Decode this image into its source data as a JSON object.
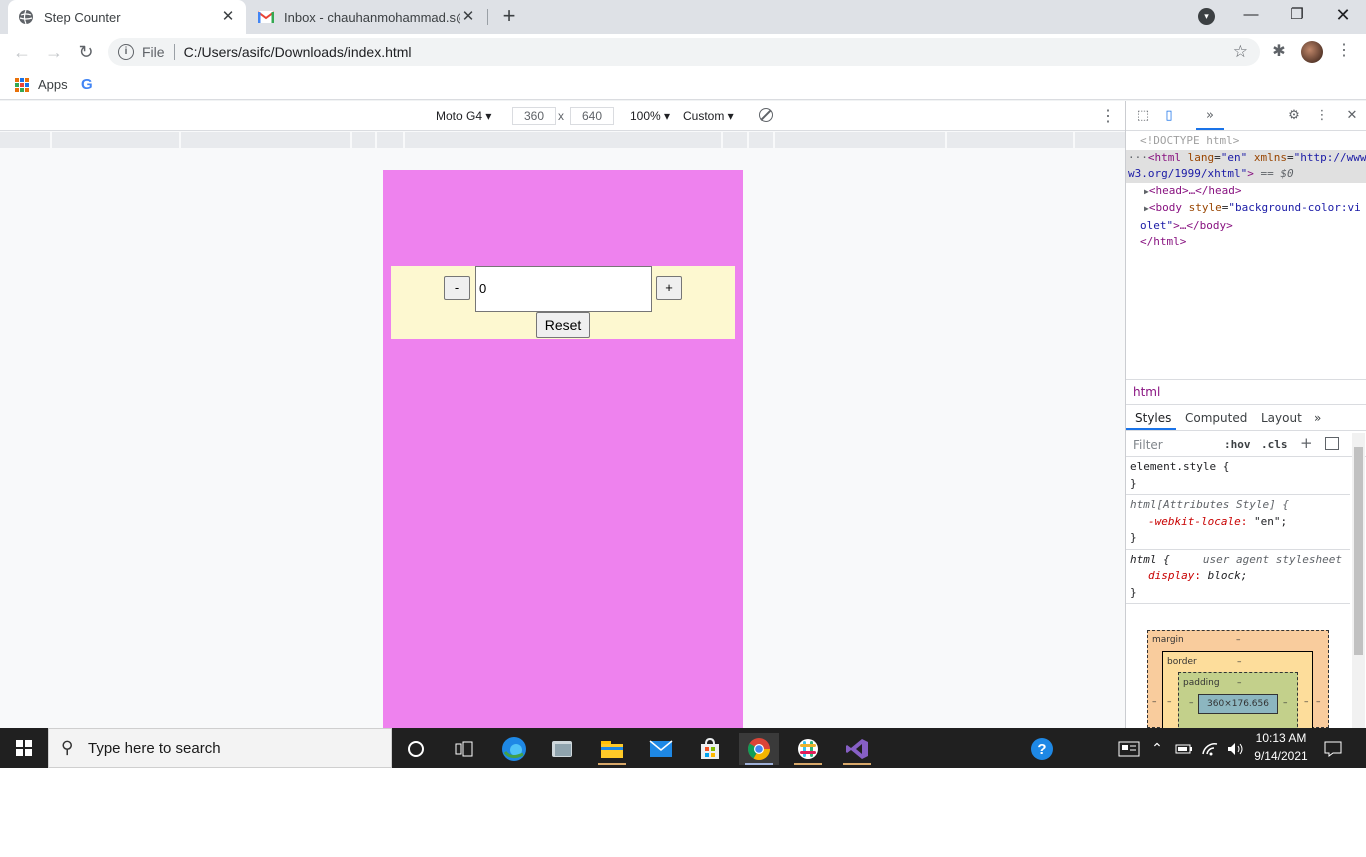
{
  "browser": {
    "tabs": [
      {
        "title": "Step Counter",
        "active": true,
        "favicon": "globe-icon"
      },
      {
        "title": "Inbox - chauhanmohammad.s@",
        "active": false,
        "favicon": "gmail-icon"
      }
    ],
    "address": {
      "scheme": "File",
      "url": "C:/Users/asifc/Downloads/index.html"
    },
    "bookmarks": {
      "apps_label": "Apps",
      "google_icon": "G"
    }
  },
  "device_toolbar": {
    "device": "Moto G4",
    "width": "360",
    "times": "x",
    "height": "640",
    "zoom": "100%",
    "throttle": "Custom"
  },
  "page": {
    "background": "#ee82ee",
    "minus_label": "-",
    "counter_value": "0",
    "plus_label": "+",
    "reset_label": "Reset"
  },
  "devtools": {
    "dom": {
      "doctype": "<!DOCTYPE html>",
      "html_open_prefix": "<html",
      "html_lang_attr": "lang",
      "html_lang_val": "\"en\"",
      "html_xmlns_attr": "xmlns",
      "html_xmlns_val": "\"http://www.",
      "html_xmlns_cont": "w3.org/1999/xhtml\"",
      "html_open_suffix": ">",
      "dollar0": "== $0",
      "head": "<head>…</head>",
      "body_open": "<body",
      "body_style_attr": "style",
      "body_style_val": "\"background-color:vi",
      "body_style_cont": "olet\"",
      "body_rest": ">…</body>",
      "html_close": "</html>"
    },
    "breadcrumb": "html",
    "panel_tabs": [
      "Styles",
      "Computed",
      "Layout"
    ],
    "filter_placeholder": "Filter",
    "hov": ":hov",
    "cls": ".cls",
    "rules": {
      "element_style": "element.style {",
      "attr_selector": "html[Attributes Style] {",
      "locale_prop": "-webkit-locale",
      "locale_val": "\"en\";",
      "html_selector": "html {",
      "ua_label": "user agent stylesheet",
      "display_prop": "display",
      "display_val": "block;",
      "close_brace": "}"
    },
    "box_model": {
      "margin_label": "margin",
      "border_label": "border",
      "padding_label": "padding",
      "dash": "–",
      "content_size": "360×176.656"
    }
  },
  "taskbar": {
    "search_placeholder": "Type here to search",
    "time": "10:13 AM",
    "date": "9/14/2021"
  }
}
